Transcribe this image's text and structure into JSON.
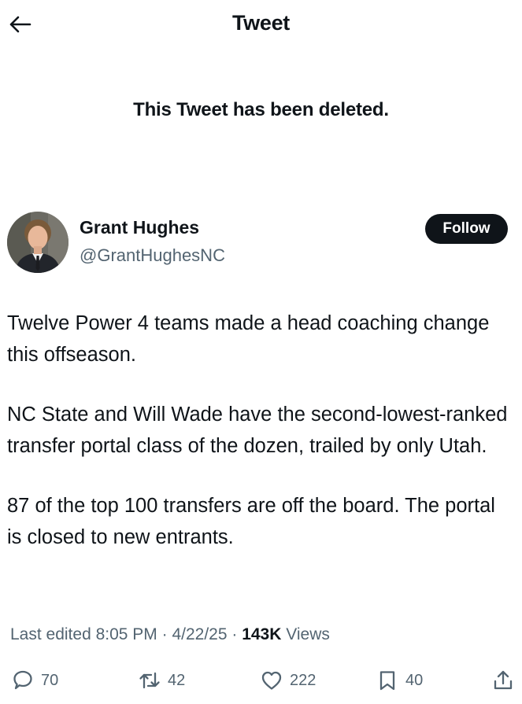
{
  "header": {
    "title": "Tweet",
    "back_icon": "arrow-left-icon"
  },
  "deleted_notice": "This Tweet has been deleted.",
  "tweet": {
    "author": {
      "name": "Grant Hughes",
      "handle": "@GrantHughesNC"
    },
    "follow_label": "Follow",
    "paragraphs": [
      "Twelve Power 4 teams made a head coaching change this offseason.",
      "NC State and Will Wade have the second-lowest-ranked transfer portal class of the dozen, trailed by only Utah.",
      "87 of the top 100 transfers are off the board. The portal is closed to new entrants."
    ],
    "meta": {
      "edited": "Last edited 8:05 PM · 4/22/25",
      "separator": "·",
      "views_count": "143K",
      "views_label": "Views"
    },
    "actions": {
      "replies": "70",
      "retweets": "42",
      "likes": "222",
      "bookmarks": "40"
    }
  },
  "colors": {
    "text": "#0f1419",
    "secondary": "#536471",
    "follow_bg": "#0f1419"
  }
}
